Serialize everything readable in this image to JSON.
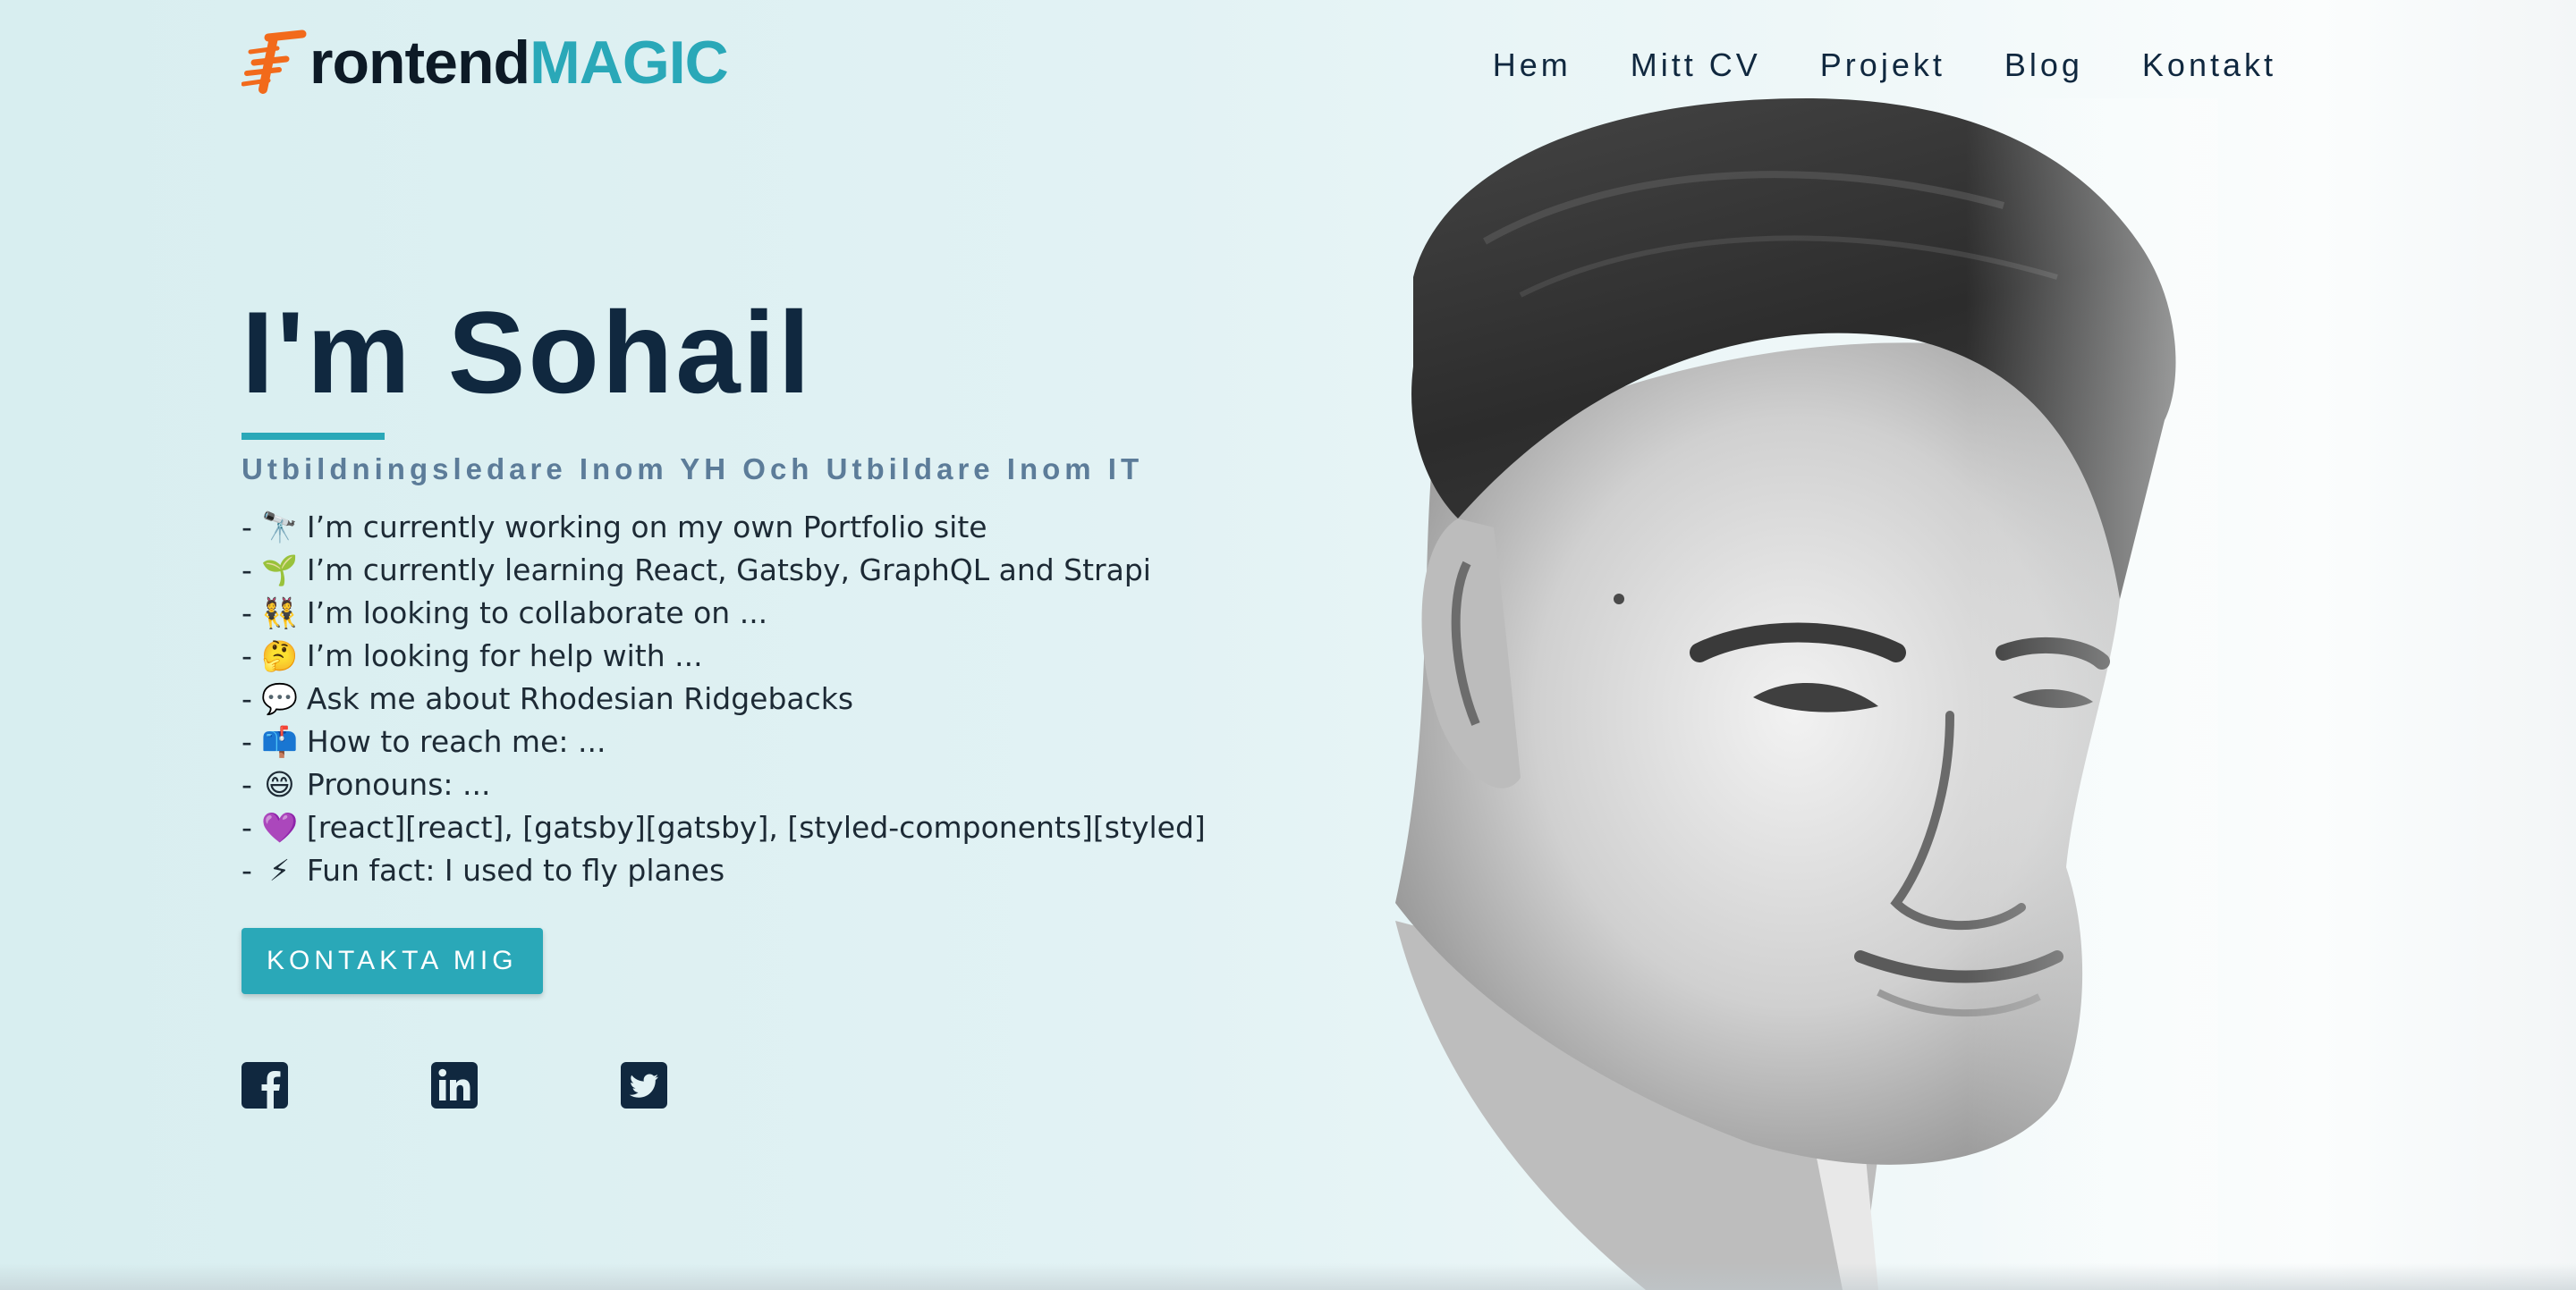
{
  "header": {
    "logo": {
      "part_dark": "rontend",
      "part_accent": "MAGIC"
    },
    "nav": [
      "Hem",
      "Mitt CV",
      "Projekt",
      "Blog",
      "Kontakt"
    ]
  },
  "hero": {
    "title": "I'm Sohail",
    "subtitle": "Utbildningsledare Inom YH Och Utbildare Inom IT",
    "bullets": [
      {
        "emoji": "🔭",
        "text": "I’m currently working on my own Portfolio site"
      },
      {
        "emoji": "🌱",
        "text": "I’m currently learning React, Gatsby, GraphQL and Strapi"
      },
      {
        "emoji": "👯",
        "text": "I’m looking to collaborate on ..."
      },
      {
        "emoji": "🤔",
        "text": "I’m looking for help with ..."
      },
      {
        "emoji": "💬",
        "text": "Ask me about Rhodesian Ridgebacks"
      },
      {
        "emoji": "📫",
        "text": "How to reach me: ..."
      },
      {
        "emoji": "😄",
        "text": "Pronouns: ..."
      },
      {
        "emoji": "💜",
        "text": "[react][react], [gatsby][gatsby], [styled-components][styled]"
      },
      {
        "emoji": "⚡",
        "text": "Fun fact: I used to fly planes"
      }
    ],
    "cta_label": "KONTAKTA MIG",
    "socials": [
      "facebook-icon",
      "linkedin-icon",
      "twitter-icon"
    ]
  },
  "colors": {
    "accent": "#2aa8b8",
    "navy": "#10283f",
    "subtitle": "#5c7c99",
    "logo_orange": "#f26a1b"
  }
}
